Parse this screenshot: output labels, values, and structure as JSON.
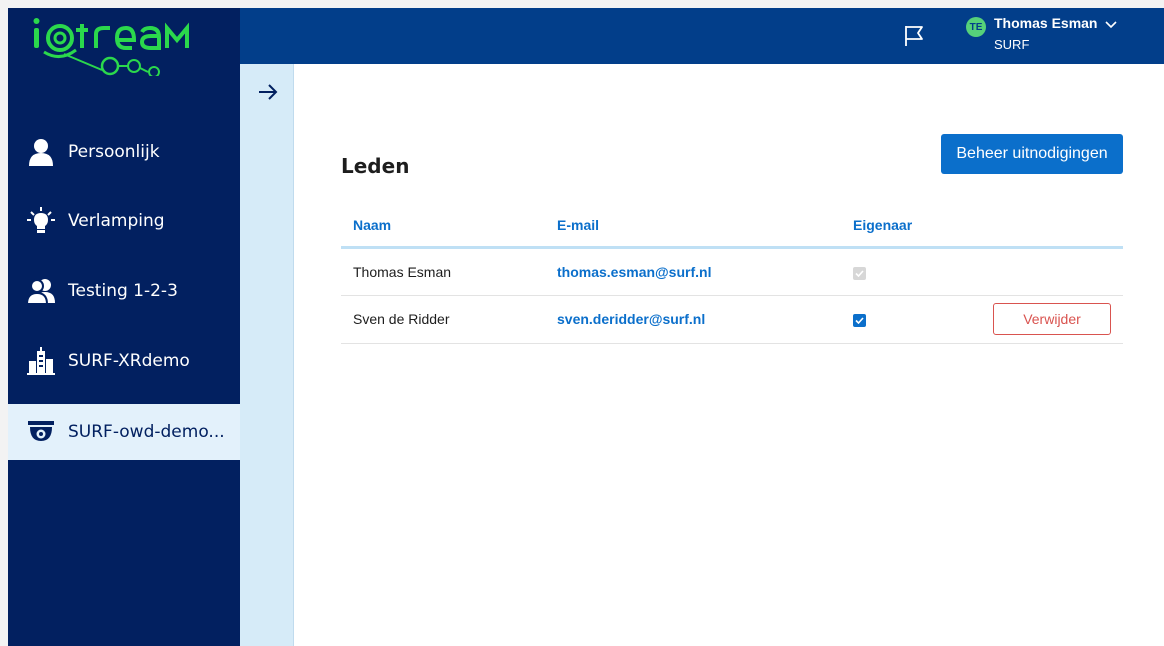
{
  "app": {
    "logo_text": "i@treaM"
  },
  "sidebar": {
    "items": [
      {
        "label": "Persoonlijk",
        "icon": "user-icon"
      },
      {
        "label": "Verlamping",
        "icon": "lightbulb-icon"
      },
      {
        "label": "Testing 1-2-3",
        "icon": "users-icon"
      },
      {
        "label": "SURF-XRdemo",
        "icon": "building-icon"
      },
      {
        "label": "SURF-owd-demo...",
        "icon": "camera-icon",
        "active": true
      }
    ]
  },
  "header": {
    "user": {
      "initials": "TE",
      "name": "Thomas Esman",
      "org": "SURF"
    },
    "flag_icon": "flag-icon"
  },
  "main": {
    "title": "Leden",
    "invite_button": "Beheer uitnodigingen",
    "table": {
      "headers": [
        "Naam",
        "E-mail",
        "Eigenaar"
      ],
      "rows": [
        {
          "name": "Thomas Esman",
          "email": "thomas.esman@surf.nl",
          "owner": true,
          "owner_disabled": true,
          "action": ""
        },
        {
          "name": "Sven de Ridder",
          "email": "sven.deridder@surf.nl",
          "owner": true,
          "owner_disabled": false,
          "action": "Verwijder"
        }
      ]
    }
  },
  "colors": {
    "sidebar_bg": "#022060",
    "topbar_bg": "#023e8a",
    "accent": "#0b6fcb",
    "logo_green": "#2bd84c",
    "danger": "#d9534f"
  }
}
